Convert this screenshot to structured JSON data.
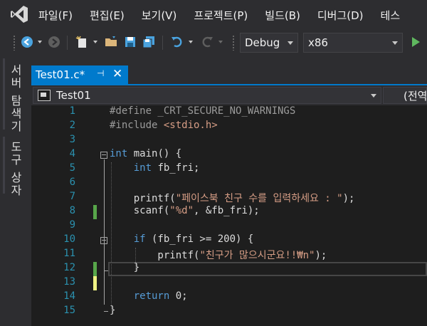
{
  "menu": {
    "items": [
      "파일(F)",
      "편집(E)",
      "보기(V)",
      "프로젝트(P)",
      "빌드(B)",
      "디버그(D)",
      "테스"
    ]
  },
  "toolbar": {
    "configuration": "Debug",
    "platform": "x86"
  },
  "side_panel": {
    "server_explorer": "서버 탐색기",
    "toolbox": "도구 상자"
  },
  "document_tab": {
    "title": "Test01.c*"
  },
  "navigation": {
    "scope": "Test01",
    "member": "(전역"
  },
  "colors": {
    "accent": "#007acc",
    "editor_bg": "#1e1e1e",
    "keyword": "#569cd6",
    "string": "#d69d85",
    "line_number": "#2b91af",
    "change_saved": "#57a64a",
    "change_unsaved": "#eff284"
  },
  "editor": {
    "lines": [
      {
        "n": "1",
        "text": "#define _CRT_SECURE_NO_WARNINGS"
      },
      {
        "n": "2",
        "text": "#include <stdio.h>"
      },
      {
        "n": "3",
        "text": ""
      },
      {
        "n": "4",
        "text": "int main() {"
      },
      {
        "n": "5",
        "text": "    int fb_fri;"
      },
      {
        "n": "6",
        "text": ""
      },
      {
        "n": "7",
        "text": "    printf(\"페이스북 친구 수를 입력하세요 : \");"
      },
      {
        "n": "8",
        "text": "    scanf(\"%d\", &fb_fri);"
      },
      {
        "n": "9",
        "text": ""
      },
      {
        "n": "10",
        "text": "    if (fb_fri >= 200) {"
      },
      {
        "n": "11",
        "text": "        printf(\"친구가 많으시군요!!₩n\");"
      },
      {
        "n": "12",
        "text": "    }"
      },
      {
        "n": "13",
        "text": ""
      },
      {
        "n": "14",
        "text": "    return 0;"
      },
      {
        "n": "15",
        "text": "}"
      }
    ]
  }
}
